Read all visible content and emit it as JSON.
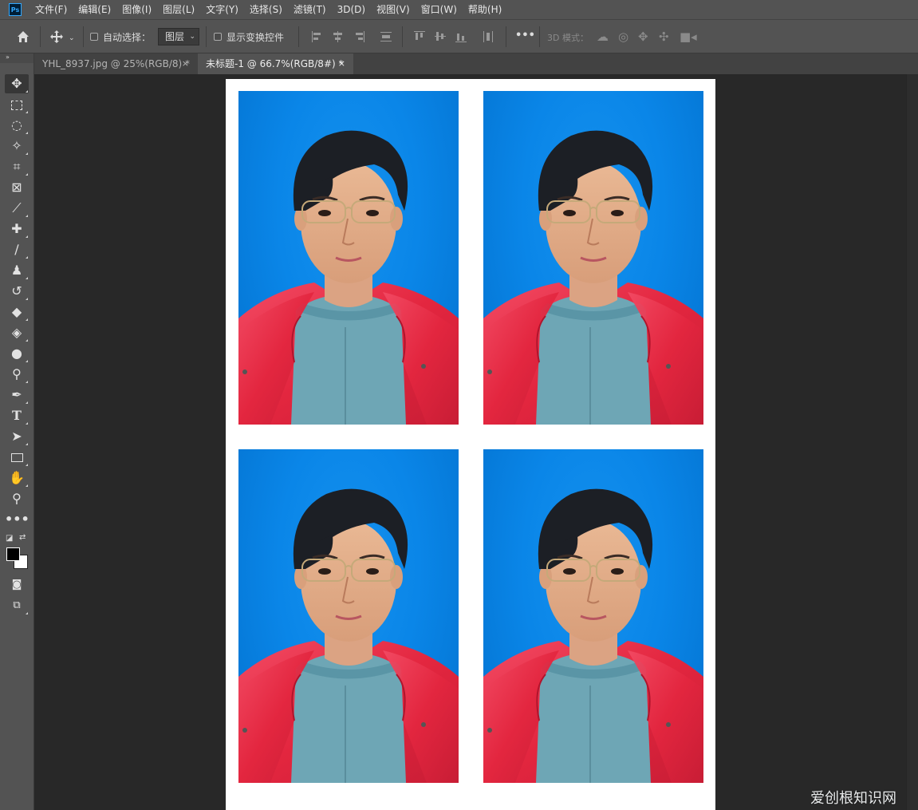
{
  "app": {
    "logo": "Ps"
  },
  "menu": [
    "文件(F)",
    "编辑(E)",
    "图像(I)",
    "图层(L)",
    "文字(Y)",
    "选择(S)",
    "滤镜(T)",
    "3D(D)",
    "视图(V)",
    "窗口(W)",
    "帮助(H)"
  ],
  "options": {
    "auto_select_label": "自动选择：",
    "auto_select_target": "图层",
    "show_transform_label": "显示变换控件",
    "more": "•••",
    "mode_3d_label": "3D 模式："
  },
  "tabs": [
    {
      "label": "YHL_8937.jpg @ 25%(RGB/8) *",
      "close": "×",
      "active": false
    },
    {
      "label": "未标题-1 @ 66.7%(RGB/8#) *",
      "close": "×",
      "active": true
    }
  ],
  "tools": {
    "collapse": "»",
    "items": [
      "move-tool",
      "marquee-tool",
      "lasso-tool",
      "magic-wand-tool",
      "crop-tool",
      "frame-tool",
      "eyedropper-tool",
      "healing-brush-tool",
      "brush-tool",
      "clone-stamp-tool",
      "history-brush-tool",
      "eraser-tool",
      "paint-bucket-tool",
      "blur-tool",
      "dodge-tool",
      "pen-tool",
      "type-tool",
      "path-selection-tool",
      "rectangle-tool",
      "hand-tool",
      "zoom-tool",
      "edit-toolbar"
    ],
    "foreground_color": "#000000",
    "background_color": "#ffffff"
  },
  "document": {
    "background": "#ffffff",
    "photo_count": 4,
    "photo_background": "#0a86e8",
    "jacket_color": "#e8304c",
    "sweater_color": "#6aa3b3"
  },
  "watermark": "爱创根知识网",
  "colors": {
    "menubar": "#535353",
    "workspace": "#282828",
    "active_tab": "#535353"
  }
}
